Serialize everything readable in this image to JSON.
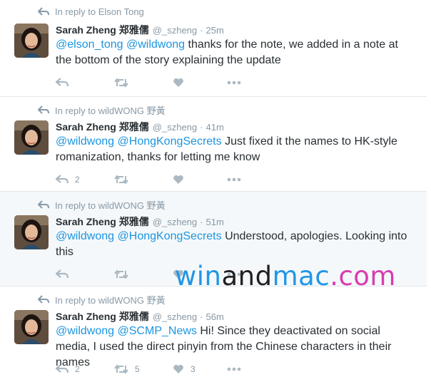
{
  "colors": {
    "accent": "#1b95e0",
    "muted": "#8899a6",
    "icon": "#aab8c2",
    "watermark_blue": "#2196e6",
    "watermark_pink": "#d93cae"
  },
  "icons": {
    "reply_context": "reply-arrow-icon",
    "reply": "reply-icon",
    "retweet": "retweet-icon",
    "like": "heart-icon",
    "more": "more-dots-icon"
  },
  "tweets": [
    {
      "reply_to": "In reply to Elson Tong",
      "name": "Sarah Zheng",
      "name_cjk": "郑雅儒",
      "handle": "@_szheng",
      "separator": "·",
      "time": "25m",
      "mentions": [
        "@elson_tong",
        "@wildwong"
      ],
      "text": "thanks for the note, we added in a note at the bottom of the story explaining the update",
      "replies": "",
      "retweets": "",
      "likes": ""
    },
    {
      "reply_to": "In reply to wildWONG 野黃",
      "name": "Sarah Zheng",
      "name_cjk": "郑雅儒",
      "handle": "@_szheng",
      "separator": "·",
      "time": "41m",
      "mentions": [
        "@wildwong",
        "@HongKongSecrets"
      ],
      "text": "Just fixed it the names to HK-style romanization, thanks for letting me know",
      "replies": "2",
      "retweets": "",
      "likes": ""
    },
    {
      "reply_to": "In reply to wildWONG 野黃",
      "name": "Sarah Zheng",
      "name_cjk": "郑雅儒",
      "handle": "@_szheng",
      "separator": "·",
      "time": "51m",
      "mentions": [
        "@wildwong",
        "@HongKongSecrets"
      ],
      "text": "Understood, apologies. Looking into this",
      "replies": "",
      "retweets": "",
      "likes": ""
    },
    {
      "reply_to": "In reply to wildWONG 野黃",
      "name": "Sarah Zheng",
      "name_cjk": "郑雅儒",
      "handle": "@_szheng",
      "separator": "·",
      "time": "56m",
      "mentions": [
        "@wildwong",
        "@SCMP_News"
      ],
      "text": "Hi! Since they deactivated on social media, I used the direct pinyin from the Chinese characters in their names",
      "replies": "2",
      "retweets": "5",
      "likes": "3"
    }
  ],
  "watermark": {
    "part1": "win",
    "part2": "and",
    "part3": "mac",
    "part4": ".com"
  }
}
